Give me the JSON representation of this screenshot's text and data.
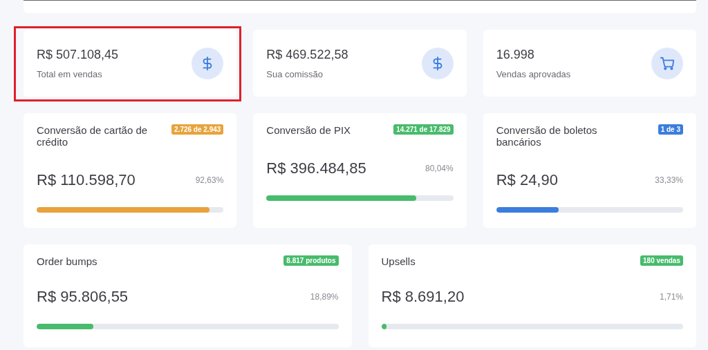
{
  "stats": [
    {
      "value": "R$ 507.108,45",
      "label": "Total em vendas",
      "kind": "dollar",
      "highlighted": true
    },
    {
      "value": "R$ 469.522,58",
      "label": "Sua comissão",
      "kind": "dollar",
      "highlighted": false
    },
    {
      "value": "16.998",
      "label": "Vendas aprovadas",
      "kind": "cart",
      "highlighted": false
    }
  ],
  "conversions": [
    {
      "title": "Conversão de cartão de crédito",
      "badge": "2.726 de 2.943",
      "color": "#e8a33d",
      "value": "R$ 110.598,70",
      "percent": "92,63%",
      "level": 0.9263
    },
    {
      "title": "Conversão de PIX",
      "badge": "14.271 de 17.829",
      "color": "#48bb6c",
      "value": "R$ 396.484,85",
      "percent": "80,04%",
      "level": 0.8004
    },
    {
      "title": "Conversão de boletos bancários",
      "badge": "1 de 3",
      "color": "#3b7ddd",
      "value": "R$ 24,90",
      "percent": "33,33%",
      "level": 0.3333
    }
  ],
  "extras": [
    {
      "title": "Order bumps",
      "badge": "8.817 produtos",
      "color": "#48bb6c",
      "value": "R$ 95.806,55",
      "percent": "18,89%",
      "level": 0.1889
    },
    {
      "title": "Upsells",
      "badge": "180 vendas",
      "color": "#48bb6c",
      "value": "R$ 8.691,20",
      "percent": "1,71%",
      "level": 0.0171
    }
  ]
}
